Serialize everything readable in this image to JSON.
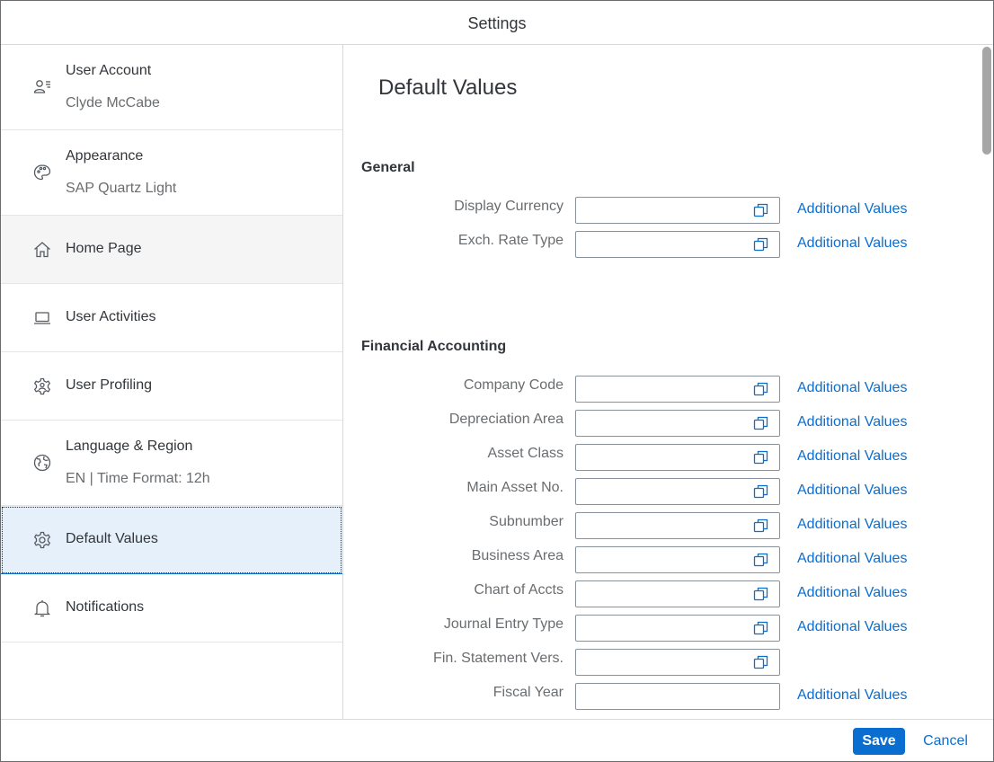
{
  "dialog": {
    "title": "Settings"
  },
  "sidebar": {
    "items": [
      {
        "title": "User Account",
        "subtitle": "Clyde McCabe",
        "icon": "user-account-icon"
      },
      {
        "title": "Appearance",
        "subtitle": "SAP Quartz Light",
        "icon": "palette-icon"
      },
      {
        "title": "Home Page",
        "icon": "home-icon"
      },
      {
        "title": "User Activities",
        "icon": "laptop-icon"
      },
      {
        "title": "User Profiling",
        "icon": "user-settings-icon"
      },
      {
        "title": "Language & Region",
        "subtitle": "EN | Time Format: 12h",
        "icon": "globe-icon"
      },
      {
        "title": "Default Values",
        "icon": "gear-icon",
        "selected": true
      },
      {
        "title": "Notifications",
        "icon": "bell-icon"
      }
    ]
  },
  "main": {
    "title": "Default Values",
    "link_label": "Additional Values",
    "sections": [
      {
        "title": "General",
        "fields": [
          {
            "label": "Display Currency",
            "value": "",
            "value_help": true,
            "additional_values": true
          },
          {
            "label": "Exch. Rate Type",
            "value": "",
            "value_help": true,
            "additional_values": true
          }
        ]
      },
      {
        "title": "Financial Accounting",
        "fields": [
          {
            "label": "Company Code",
            "value": "",
            "value_help": true,
            "additional_values": true
          },
          {
            "label": "Depreciation Area",
            "value": "",
            "value_help": true,
            "additional_values": true
          },
          {
            "label": "Asset Class",
            "value": "",
            "value_help": true,
            "additional_values": true
          },
          {
            "label": "Main Asset No.",
            "value": "",
            "value_help": true,
            "additional_values": true
          },
          {
            "label": "Subnumber",
            "value": "",
            "value_help": true,
            "additional_values": true
          },
          {
            "label": "Business Area",
            "value": "",
            "value_help": true,
            "additional_values": true
          },
          {
            "label": "Chart of Accts",
            "value": "",
            "value_help": true,
            "additional_values": true
          },
          {
            "label": "Journal Entry Type",
            "value": "",
            "value_help": true,
            "additional_values": true
          },
          {
            "label": "Fin. Statement Vers.",
            "value": "",
            "value_help": true,
            "additional_values": false
          },
          {
            "label": "Fiscal Year",
            "value": "",
            "value_help": false,
            "additional_values": true
          }
        ]
      }
    ]
  },
  "footer": {
    "save_label": "Save",
    "cancel_label": "Cancel"
  },
  "colors": {
    "accent": "#0a6ed1",
    "selected_bg": "#e5f0fa",
    "hover_bg": "#f5f5f5"
  }
}
